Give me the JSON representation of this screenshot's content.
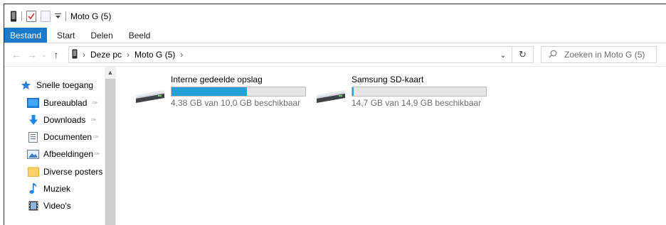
{
  "titlebar": {
    "title": "Moto G (5)"
  },
  "ribbon": {
    "tabs": [
      "Bestand",
      "Start",
      "Delen",
      "Beeld"
    ]
  },
  "address": {
    "crumbs": [
      "Deze pc",
      "Moto G (5)"
    ],
    "search_placeholder": "Zoeken in Moto G (5)"
  },
  "nav": {
    "quick_access": "Snelle toegang",
    "items": [
      {
        "label": "Bureaublad",
        "pinned": true,
        "icon": "desktop-icon"
      },
      {
        "label": "Downloads",
        "pinned": true,
        "icon": "download-icon"
      },
      {
        "label": "Documenten",
        "pinned": true,
        "icon": "document-icon"
      },
      {
        "label": "Afbeeldingen",
        "pinned": true,
        "icon": "pictures-icon"
      },
      {
        "label": "Diverse posters",
        "pinned": false,
        "icon": "folder-icon"
      },
      {
        "label": "Muziek",
        "pinned": false,
        "icon": "music-icon"
      },
      {
        "label": "Video's",
        "pinned": false,
        "icon": "video-icon"
      }
    ]
  },
  "drives": [
    {
      "name": "Interne gedeelde opslag",
      "free_text": "4,38 GB van 10,0 GB beschikbaar",
      "used_fraction": 0.562
    },
    {
      "name": "Samsung SD-kaart",
      "free_text": "14,7 GB van 14,9 GB beschikbaar",
      "used_fraction": 0.013
    }
  ],
  "colors": {
    "accent": "#1979ca",
    "bar_fill": "#26a0da"
  }
}
